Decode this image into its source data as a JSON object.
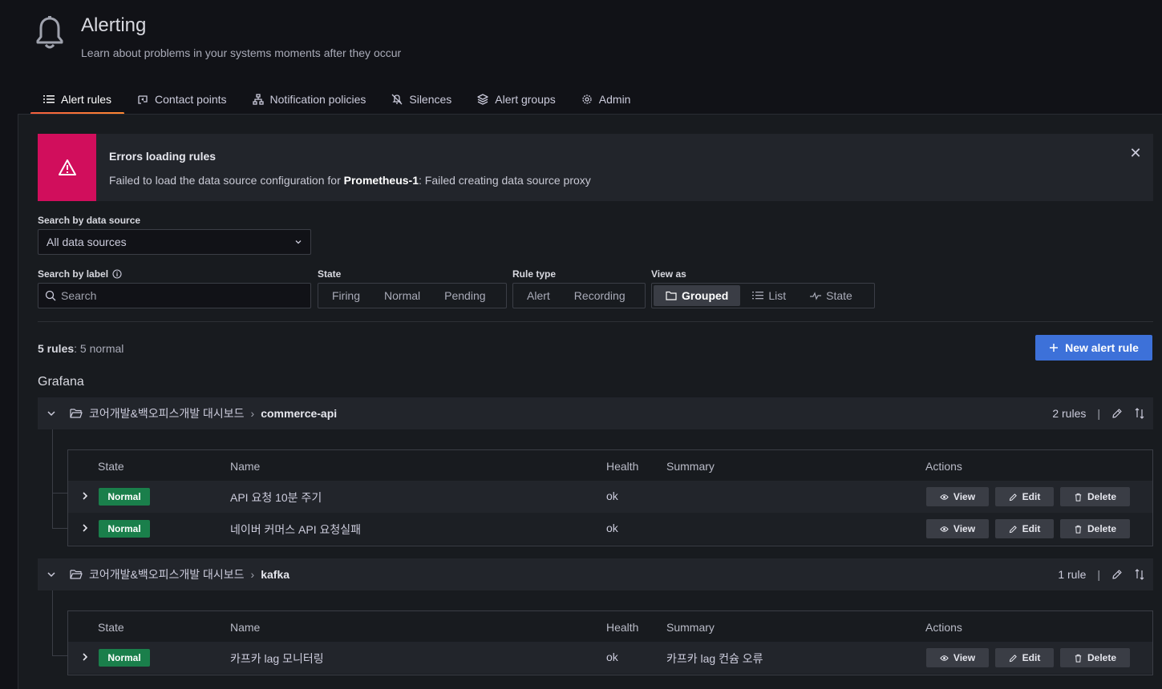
{
  "page": {
    "title": "Alerting",
    "subtitle": "Learn about problems in your systems moments after they occur"
  },
  "tabs": [
    {
      "label": "Alert rules",
      "icon": "list-icon",
      "active": true
    },
    {
      "label": "Contact points",
      "icon": "comment-alt-share-icon",
      "active": false
    },
    {
      "label": "Notification policies",
      "icon": "sitemap-icon",
      "active": false
    },
    {
      "label": "Silences",
      "icon": "bell-slash-icon",
      "active": false
    },
    {
      "label": "Alert groups",
      "icon": "layer-group-icon",
      "active": false
    },
    {
      "label": "Admin",
      "icon": "cog-icon",
      "active": false
    }
  ],
  "error_alert": {
    "title": "Errors loading rules",
    "message_prefix": "Failed to load the data source configuration for ",
    "datasource": "Prometheus-1",
    "message_suffix": ": Failed creating data source proxy",
    "icon": "exclamation-triangle-icon",
    "close_icon": "close-icon"
  },
  "filters": {
    "datasource_label": "Search by data source",
    "datasource_value": "All data sources",
    "label_label": "Search by label",
    "label_placeholder": "Search",
    "state_label": "State",
    "state_options": [
      "Firing",
      "Normal",
      "Pending"
    ],
    "rule_type_label": "Rule type",
    "rule_type_options": [
      "Alert",
      "Recording"
    ],
    "view_as_label": "View as",
    "view_as_options": [
      "Grouped",
      "List",
      "State"
    ],
    "view_as_selected": "Grouped"
  },
  "summary": {
    "count": "5 rules",
    "detail": ": 5 normal"
  },
  "new_rule_button": "New alert rule",
  "namespace": "Grafana",
  "groups": [
    {
      "folder": "코어개발&백오피스개발 대시보드",
      "separator": "›",
      "group": "commerce-api",
      "rule_count": "2 rules",
      "divider": "|",
      "columns": [
        "State",
        "Name",
        "Health",
        "Summary",
        "Actions"
      ],
      "rules": [
        {
          "state": "Normal",
          "name": "API 요청 10분 주기",
          "health": "ok",
          "summary": ""
        },
        {
          "state": "Normal",
          "name": "네이버 커머스 API 요청실패",
          "health": "ok",
          "summary": ""
        }
      ]
    },
    {
      "folder": "코어개발&백오피스개발 대시보드",
      "separator": "›",
      "group": "kafka",
      "rule_count": "1 rule",
      "divider": "|",
      "columns": [
        "State",
        "Name",
        "Health",
        "Summary",
        "Actions"
      ],
      "rules": [
        {
          "state": "Normal",
          "name": "카프카 lag 모니터링",
          "health": "ok",
          "summary": "카프카 lag 컨슘 오류"
        }
      ]
    }
  ],
  "actions": {
    "view": "View",
    "edit": "Edit",
    "delete": "Delete"
  },
  "colors": {
    "accent_blue": "#3d71d9",
    "error_pink": "#d10e5c",
    "normal_green": "#1a7f4b",
    "tab_underline": "#f55f3e"
  }
}
